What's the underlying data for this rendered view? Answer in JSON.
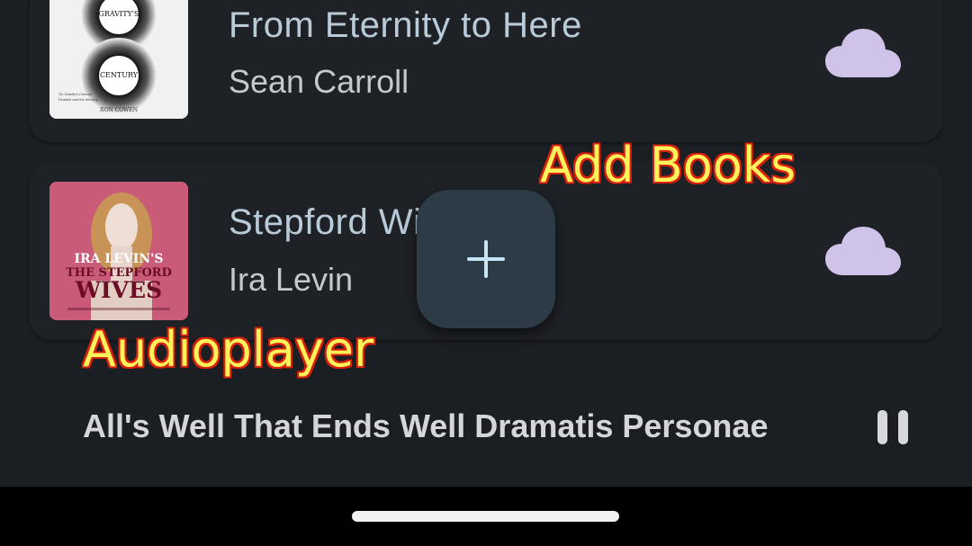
{
  "books": [
    {
      "title": "From Eternity to Here",
      "author": "Sean Carroll",
      "cover_lines": [
        "GRAVITY'S",
        "CENTURY",
        "RON COWEN"
      ],
      "status_icon": "cloud-icon"
    },
    {
      "title": "Stepford Wives",
      "author": "Ira Levin",
      "cover_lines": [
        "IRA LEVIN'S",
        "THE STEPFORD",
        "WIVES"
      ],
      "status_icon": "cloud-icon"
    }
  ],
  "fab": {
    "icon": "plus-icon"
  },
  "annotations": {
    "add_books": "Add Books",
    "audioplayer": "Audioplayer"
  },
  "player": {
    "now_playing": "All's Well That Ends Well Dramatis Personae",
    "control_icon": "pause-icon"
  },
  "colors": {
    "background": "#1b1e22",
    "card": "#1e2126",
    "cloud": "#cfc3ea",
    "fab": "#2c3b46",
    "title_text": "#b9cbd8",
    "annotation_text": "#fff35a",
    "annotation_outline": "#d9200f"
  }
}
